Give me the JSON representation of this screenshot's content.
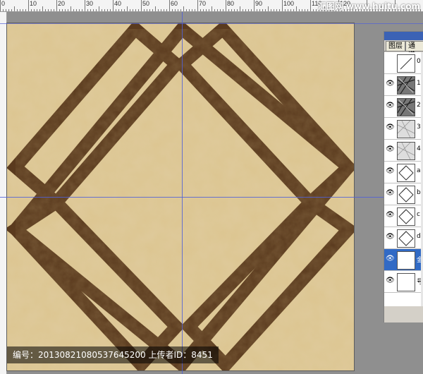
{
  "watermark_top": "汇图网 www.huitu.com",
  "ruler": {
    "labels": [
      "0",
      "10",
      "20",
      "30",
      "40",
      "50",
      "60",
      "70",
      "80",
      "90",
      "100",
      "110",
      "120"
    ]
  },
  "caption": "编号：20130821080537645200 上传者ID：8451",
  "panel": {
    "tabs": [
      "图层",
      "通道"
    ],
    "layers": [
      {
        "label": "0",
        "thumb": "blank-slash",
        "visible": false
      },
      {
        "label": "1",
        "thumb": "texture-dark",
        "visible": true
      },
      {
        "label": "2",
        "thumb": "texture-dark",
        "visible": true
      },
      {
        "label": "3",
        "thumb": "texture-light",
        "visible": true
      },
      {
        "label": "4",
        "thumb": "texture-light",
        "visible": true
      },
      {
        "label": "a",
        "thumb": "diamond-outline",
        "visible": true
      },
      {
        "label": "b",
        "thumb": "diamond-outline",
        "visible": true
      },
      {
        "label": "c",
        "thumb": "diamond-outline",
        "visible": true
      },
      {
        "label": "d",
        "thumb": "diamond-outline",
        "visible": true
      },
      {
        "label": "金",
        "thumb": "white",
        "visible": true,
        "selected": true
      },
      {
        "label": "号",
        "thumb": "white",
        "visible": true
      }
    ]
  },
  "colors": {
    "marble": "#d8c08a",
    "strip": "#5a3a1e",
    "guide": "#5060d8",
    "selection": "#316ac5"
  }
}
